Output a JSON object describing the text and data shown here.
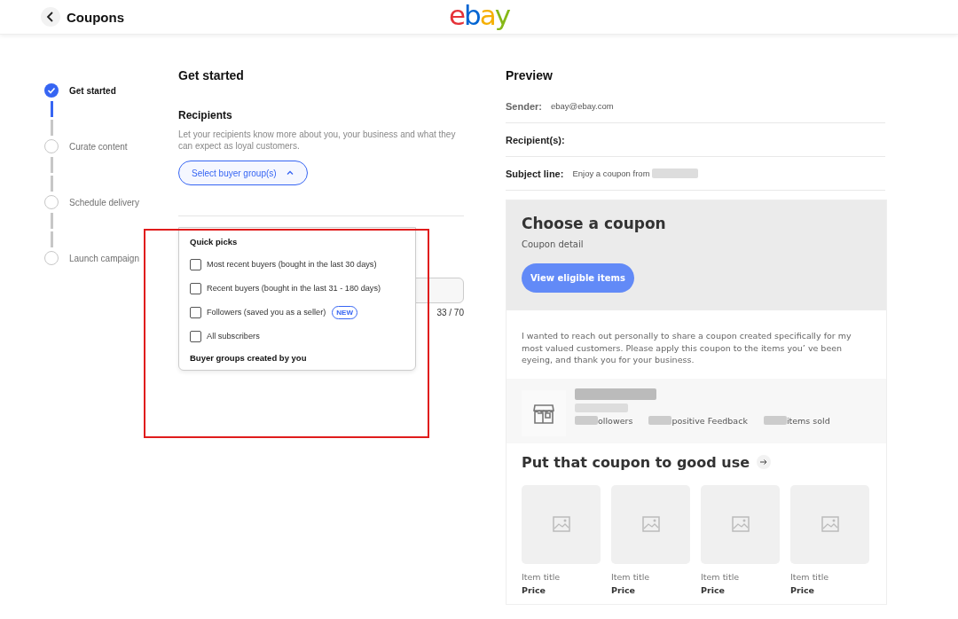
{
  "header": {
    "title": "Coupons",
    "logo": [
      {
        "letter": "e",
        "color": "#e53238"
      },
      {
        "letter": "b",
        "color": "#0064d2"
      },
      {
        "letter": "a",
        "color": "#f5af02"
      },
      {
        "letter": "y",
        "color": "#86b817"
      }
    ]
  },
  "steps": [
    {
      "label": "Get started",
      "completed": true
    },
    {
      "label": "Curate content",
      "completed": false
    },
    {
      "label": "Schedule delivery",
      "completed": false
    },
    {
      "label": "Launch campaign",
      "completed": false
    }
  ],
  "form": {
    "title": "Get started",
    "section": "Recipients",
    "description": "Let your recipients know more about you, your business and what they can expect as loyal customers.",
    "select_button": "Select buyer group(s)",
    "expanded": true,
    "counter": "33 / 70",
    "dropdown": {
      "heading": "Quick picks",
      "options": [
        {
          "label": "Most recent buyers (bought in the last 30 days)",
          "checked": false
        },
        {
          "label": "Recent buyers (bought in the last 31 - 180 days)",
          "checked": false
        },
        {
          "label": "Followers (saved you as a seller)",
          "checked": false,
          "badge": "NEW"
        },
        {
          "label": "All subscribers",
          "checked": false
        }
      ],
      "footer_heading": "Buyer groups created by you"
    }
  },
  "preview": {
    "title": "Preview",
    "fields": [
      {
        "label": "Sender:",
        "value": "ebay@ebay.com"
      },
      {
        "label": "Recipient(s):"
      },
      {
        "label": "Subject line:",
        "value": "Enjoy a coupon from",
        "redacted": true
      }
    ],
    "coupon": {
      "title": "Choose a coupon",
      "detail": "Coupon detail",
      "button": "View eligible items"
    },
    "message": "I wanted to reach out personally to share a coupon created specifically for my most valued customers. Please apply this coupon to the items you’   ve been eyeing, and thank you for your business.",
    "store": {
      "stats": [
        "ollowers",
        "positive Feedback",
        "items sold"
      ]
    },
    "items_title": "Put that coupon to good use",
    "items": [
      {
        "title": "Item title",
        "price": "Price"
      },
      {
        "title": "Item title",
        "price": "Price"
      },
      {
        "title": "Item title",
        "price": "Price"
      },
      {
        "title": "Item title",
        "price": "Price"
      }
    ]
  }
}
